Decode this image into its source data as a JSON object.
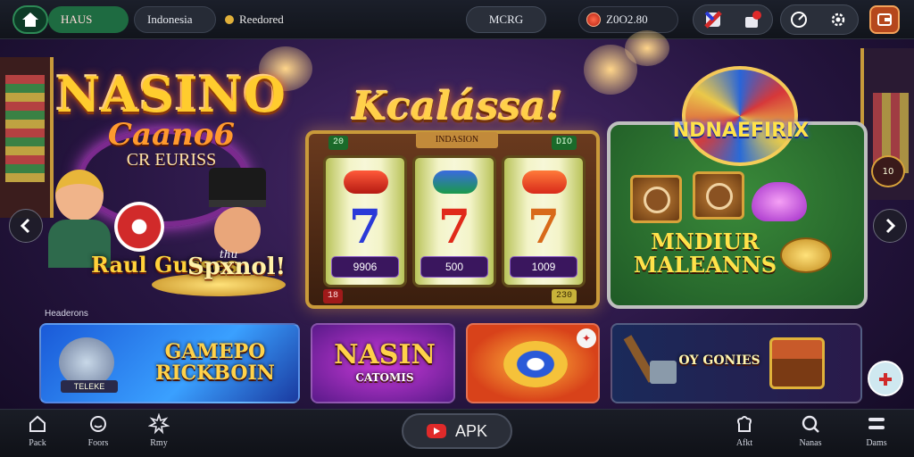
{
  "topbar": {
    "chip_green": "HAUS",
    "chip_country": "Indonesia",
    "chip_plain": "Reedored",
    "search_label": "MCRG",
    "balance": "Z0O2.80"
  },
  "hero": {
    "logo_big": "NASINO",
    "logo_sub1": "Caano6",
    "logo_sub2": "CR EURISS",
    "char_label_left": "Raul Gusses",
    "char_label_right": "Spxnol!",
    "char_label_right_small": "thu",
    "title_center": "Kcalássa!",
    "slot_header": "INDASION",
    "slot_tag_tl": "20",
    "slot_tag_tr": "DIO",
    "slot_tag_bl": "18",
    "slot_tag_br": "230",
    "reels": [
      {
        "symbol": "7",
        "value": "9906"
      },
      {
        "symbol": "7",
        "value": "500"
      },
      {
        "symbol": "7",
        "value": "1009"
      }
    ],
    "promo_badge": "NDNAEFIRIX",
    "promo_title": "MNDIUR MALEANNS",
    "side_badge": "10"
  },
  "section_label": "Headerons",
  "tiles": [
    {
      "text": "GAMEPO RICKBOIN",
      "sublabel": "TELEKE"
    },
    {
      "text": "NASIN",
      "sublabel": "CATOMIS"
    },
    {
      "text": ""
    },
    {
      "text": "OY GONIES"
    }
  ],
  "bottomnav": {
    "items": [
      {
        "label": "Pack"
      },
      {
        "label": "Foors"
      },
      {
        "label": "Rmy"
      },
      {
        "label": "Afkt"
      },
      {
        "label": "Nanas"
      },
      {
        "label": "Dams"
      }
    ],
    "apk_label": "APK"
  },
  "colors": {
    "accent_green": "#1e6b41",
    "gold": "#ffcc2e",
    "purple_bg": "#4a2a6e",
    "apk_red": "#e02a2a"
  }
}
